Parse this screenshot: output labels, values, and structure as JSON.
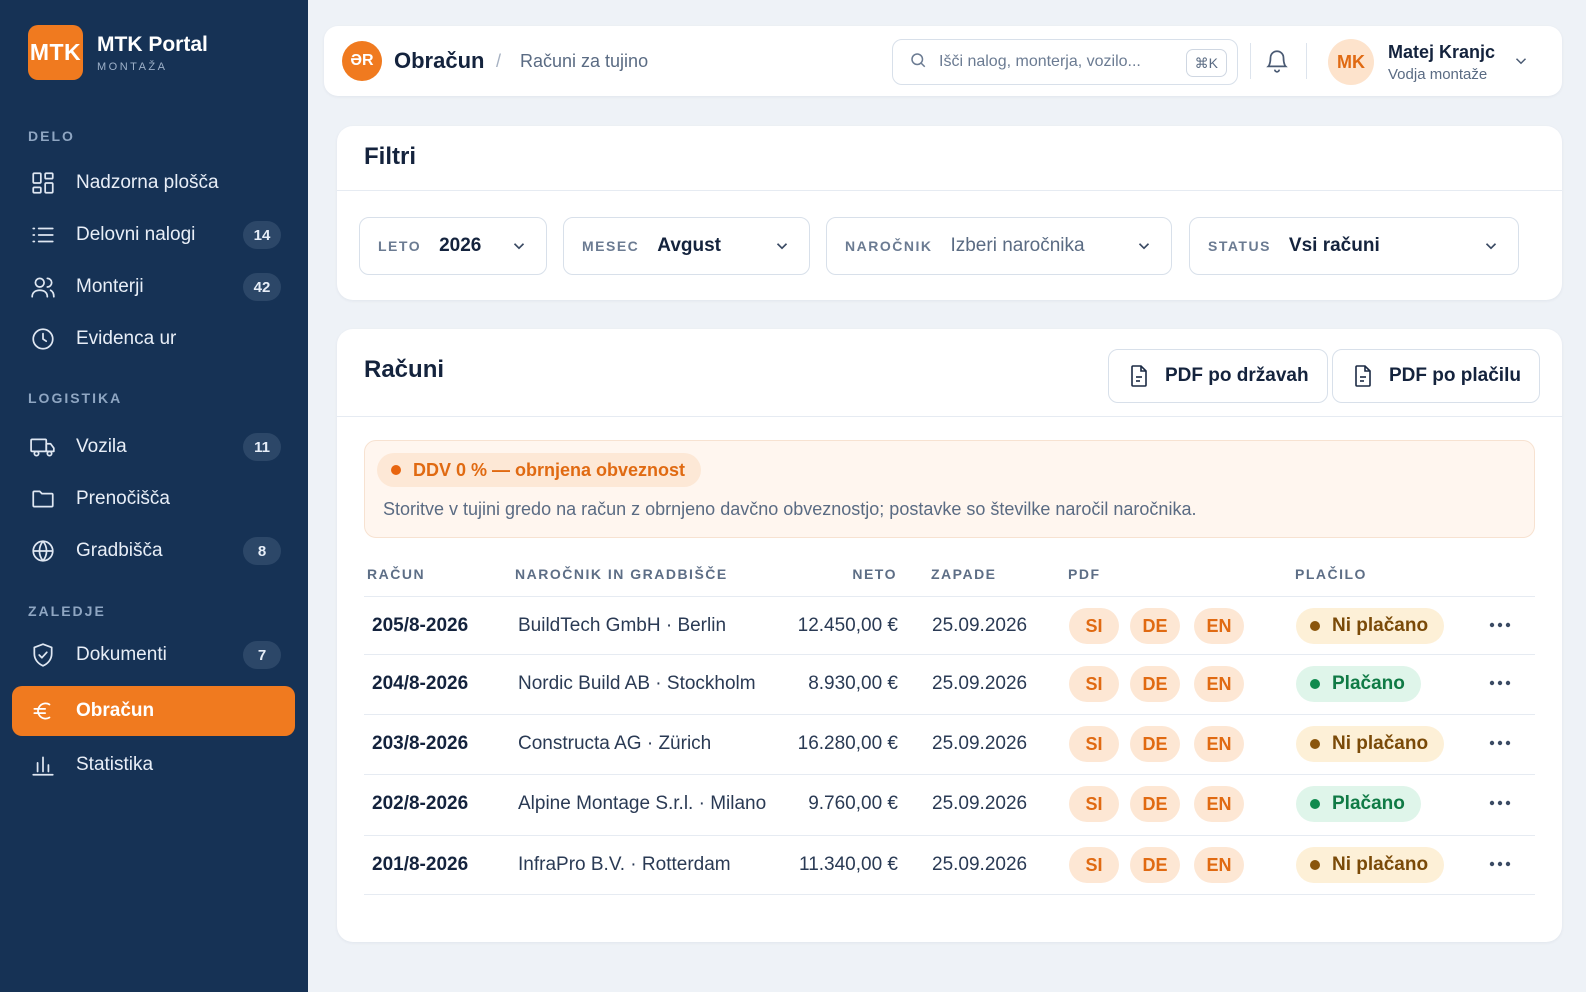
{
  "brand": {
    "logo": "MTK",
    "name": "MTK Portal",
    "subtitle": "MONTAŽA"
  },
  "sidebar": {
    "sections": [
      {
        "label": "DELO"
      },
      {
        "label": "LOGISTIKA"
      },
      {
        "label": "ZALEDJE"
      }
    ],
    "items": [
      {
        "label": "Nadzorna plošča",
        "icon": "dashboard-icon"
      },
      {
        "label": "Delovni nalogi",
        "icon": "list-icon",
        "badge": "14"
      },
      {
        "label": "Monterji",
        "icon": "users-icon",
        "badge": "42"
      },
      {
        "label": "Evidenca ur",
        "icon": "clock-icon"
      },
      {
        "label": "Vozila",
        "icon": "truck-icon",
        "badge": "11"
      },
      {
        "label": "Prenočišča",
        "icon": "folder-icon"
      },
      {
        "label": "Gradbišča",
        "icon": "globe-icon",
        "badge": "8"
      },
      {
        "label": "Dokumenti",
        "icon": "shield-icon",
        "badge": "7"
      },
      {
        "label": "Obračun",
        "icon": "euro-icon",
        "active": true
      },
      {
        "label": "Statistika",
        "icon": "bar-chart-icon"
      }
    ]
  },
  "header": {
    "logo": "ƏR",
    "title": "Obračun",
    "separator": "/",
    "breadcrumb": "Računi za tujino",
    "search": {
      "placeholder": "Išči nalog, monterja, vozilo...",
      "shortcut": "⌘K"
    },
    "user": {
      "initials": "MK",
      "name": "Matej Kranjc",
      "role": "Vodja montaže"
    }
  },
  "filters": {
    "title": "Filtri",
    "fields": [
      {
        "label": "LETO",
        "value": "2026"
      },
      {
        "label": "MESEC",
        "value": "Avgust"
      },
      {
        "label": "NAROČNIK",
        "value": "Izberi naročnika"
      },
      {
        "label": "STATUS",
        "value": "Vsi računi"
      }
    ]
  },
  "invoices": {
    "title": "Računi",
    "buttons": {
      "pdf_by_country": "PDF po državah",
      "pdf_by_payment": "PDF po plačilu"
    },
    "notice": {
      "badge": "DDV 0 % — obrnjena obveznost",
      "text": "Storitve v tujini gredo na račun z obrnjeno davčno obveznostjo; postavke so številke naročil naročnika."
    },
    "columns": {
      "invoice": "RAČUN",
      "customer": "NAROČNIK IN GRADBIŠČE",
      "net": "NETO",
      "due": "ZAPADE",
      "pdf": "PDF",
      "payment": "PLAČILO"
    },
    "pdf_langs": [
      "SI",
      "DE",
      "EN"
    ],
    "rows": [
      {
        "invoice": "205/8-2026",
        "customer": "BuildTech GmbH · Berlin",
        "net": "12.450,00 €",
        "due": "25.09.2026",
        "status": "Ni plačano",
        "paid": false
      },
      {
        "invoice": "204/8-2026",
        "customer": "Nordic Build AB · Stockholm",
        "net": "8.930,00 €",
        "due": "25.09.2026",
        "status": "Plačano",
        "paid": true
      },
      {
        "invoice": "203/8-2026",
        "customer": "Constructa AG · Zürich",
        "net": "16.280,00 €",
        "due": "25.09.2026",
        "status": "Ni plačano",
        "paid": false
      },
      {
        "invoice": "202/8-2026",
        "customer": "Alpine Montage S.r.l. · Milano",
        "net": "9.760,00 €",
        "due": "25.09.2026",
        "status": "Plačano",
        "paid": true
      },
      {
        "invoice": "201/8-2026",
        "customer": "InfraPro B.V. · Rotterdam",
        "net": "11.340,00 €",
        "due": "25.09.2026",
        "status": "Ni plačano",
        "paid": false
      }
    ]
  },
  "colors": {
    "accent": "#f07a1f",
    "sidebar": "#163255",
    "paid": "#0f7a45",
    "unpaid": "#7a4a08"
  }
}
